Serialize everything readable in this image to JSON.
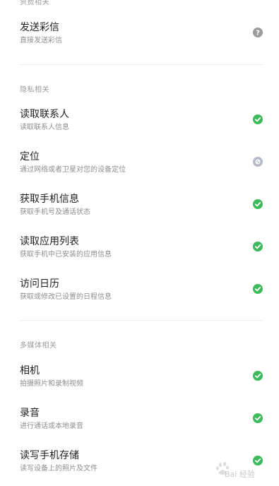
{
  "sections": {
    "top_partial_header": "资费相关",
    "privacy_header": "隐私相关",
    "media_header": "多媒体相关"
  },
  "items": [
    {
      "title": "发送彩信",
      "subtitle": "直接发送彩信",
      "status": "ask",
      "status_icon": "question-icon"
    },
    {
      "title": "读取联系人",
      "subtitle": "读取联系人信息",
      "status": "allowed",
      "status_icon": "check-icon"
    },
    {
      "title": "定位",
      "subtitle": "通过网络或者卫星对您的设备定位",
      "status": "denied",
      "status_icon": "blocked-icon"
    },
    {
      "title": "获取手机信息",
      "subtitle": "获取手机号及通话状态",
      "status": "allowed",
      "status_icon": "check-icon"
    },
    {
      "title": "读取应用列表",
      "subtitle": "获取手机中已安装的应用信息",
      "status": "allowed",
      "status_icon": "check-icon"
    },
    {
      "title": "访问日历",
      "subtitle": "获取或修改已设置的日程信息",
      "status": "allowed",
      "status_icon": "check-icon"
    },
    {
      "title": "相机",
      "subtitle": "拍摄照片和录制视频",
      "status": "allowed",
      "status_icon": "check-icon"
    },
    {
      "title": "录音",
      "subtitle": "进行通话或本地录音",
      "status": "allowed",
      "status_icon": "check-icon"
    },
    {
      "title": "读写手机存储",
      "subtitle": "读写设备上的照片及文件",
      "status": "allowed",
      "status_icon": "check-icon"
    }
  ],
  "colors": {
    "allowed": "#3dbb5c",
    "ask": "#9b9b9b",
    "denied": "#b7b9c7"
  },
  "watermark": {
    "text": "Bai 经验"
  }
}
